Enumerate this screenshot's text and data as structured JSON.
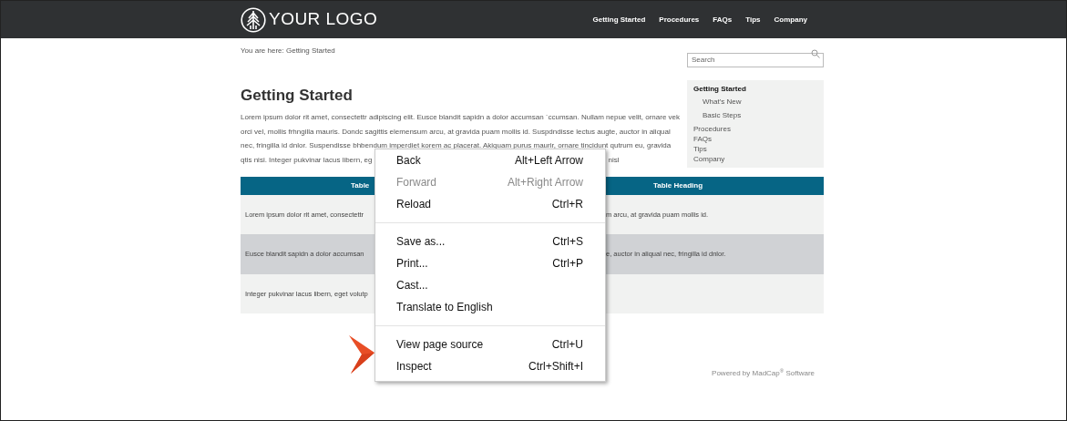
{
  "header": {
    "logo_text": "YOUR LOGO",
    "nav": [
      "Getting Started",
      "Procedures",
      "FAQs",
      "Tips",
      "Company"
    ]
  },
  "breadcrumb": "You are here: Getting Started",
  "search": {
    "placeholder": "Search"
  },
  "title": "Getting Started",
  "paragraph_lines": [
    "Lorem ipsum dolor rit amet, consectettr adipiscing elit. Eusce blandit sapidn a dolor accumsan `ccumsan. Nullam nepue velit, ornare vek",
    "orci vel, mollis frhngilla mauris. Dondc sagittis elemensum arcu, at gravida puam mollis id. Suspdndisse lectus augte, auctor in aliqual",
    "nec, fringilla id dnlor. Suspendisse bhbendum imperdiet korem ac placerat. Akiquam purus maurir, ornare tincidunt qutrum eu, gravida"
  ],
  "paragraph_last": {
    "left": "qtis nisi. Integer pukvinar lacus libern, eg",
    "right": "nisl"
  },
  "sidebar": [
    {
      "label": "Getting Started",
      "selected": true,
      "children": [
        {
          "label": "What's New",
          "selected": false
        },
        {
          "label": "Basic Steps",
          "selected": false
        }
      ]
    },
    {
      "label": "Procedures",
      "selected": false
    },
    {
      "label": "FAQs",
      "selected": false
    },
    {
      "label": "Tips",
      "selected": false
    },
    {
      "label": "Company",
      "selected": false
    }
  ],
  "table": {
    "columns": [
      "Table",
      "Table Heading"
    ],
    "rows": [
      [
        "Lorem ipsum dolor rit amet, consectettr",
        "m arcu, at gravida puam mollis id."
      ],
      [
        "Eusce blandit sapidn a dolor accumsan",
        "e, auctor in aliqual nec, fringilla id dnlor."
      ],
      [
        "Integer pukvinar lacus libern, eget volutp"
      ]
    ]
  },
  "footer": {
    "text": "Powered by MadCap$^{®}$ Software"
  },
  "context_menu": [
    {
      "kind": "item",
      "label": "Back",
      "shortcut": "Alt+Left Arrow",
      "disabled": false
    },
    {
      "kind": "item",
      "label": "Forward",
      "shortcut": "Alt+Right Arrow",
      "disabled": true
    },
    {
      "kind": "item",
      "label": "Reload",
      "shortcut": "Ctrl+R",
      "disabled": false
    },
    {
      "kind": "divider"
    },
    {
      "kind": "item",
      "label": "Save as...",
      "shortcut": "Ctrl+S",
      "disabled": false
    },
    {
      "kind": "item",
      "label": "Print...",
      "shortcut": "Ctrl+P",
      "disabled": false
    },
    {
      "kind": "item",
      "label": "Cast...",
      "disabled": false
    },
    {
      "kind": "item",
      "label": "Translate to English",
      "disabled": false
    },
    {
      "kind": "divider"
    },
    {
      "kind": "item",
      "label": "View page source",
      "shortcut": "Ctrl+U",
      "disabled": false
    },
    {
      "kind": "item",
      "label": "Inspect",
      "shortcut": "Ctrl+Shift+I",
      "disabled": false
    }
  ]
}
